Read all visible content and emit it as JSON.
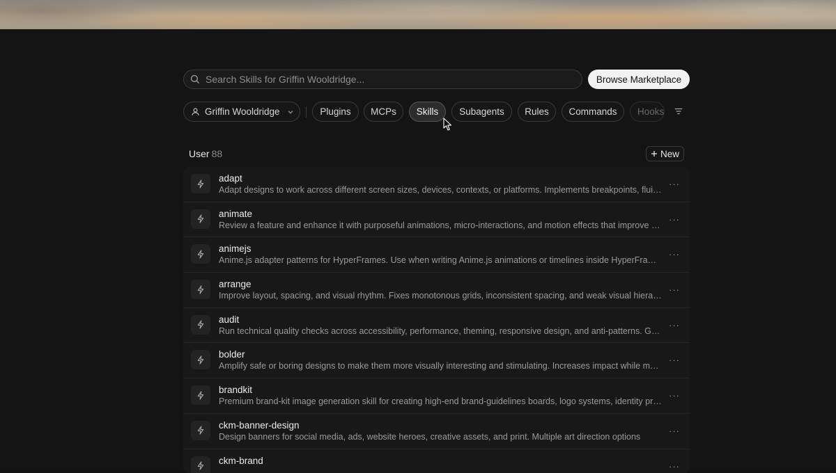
{
  "search": {
    "placeholder": "Search Skills for Griffin Wooldridge...",
    "browse_label": "Browse Marketplace"
  },
  "filters": {
    "user_label": "Griffin Wooldridge",
    "tabs": [
      "Plugins",
      "MCPs",
      "Skills",
      "Subagents",
      "Rules",
      "Commands",
      "Hooks"
    ],
    "active_tab": "Skills"
  },
  "section": {
    "title": "User",
    "count": "88",
    "new_label": "New"
  },
  "skills": [
    {
      "name": "adapt",
      "description": "Adapt designs to work across different screen sizes, devices, contexts, or platforms. Implements breakpoints, fluid layouts"
    },
    {
      "name": "animate",
      "description": "Review a feature and enhance it with purposeful animations, micro-interactions, and motion effects that improve usability"
    },
    {
      "name": "animejs",
      "description": "Anime.js adapter patterns for HyperFrames. Use when writing Anime.js animations or timelines inside HyperFrames compositions"
    },
    {
      "name": "arrange",
      "description": "Improve layout, spacing, and visual rhythm. Fixes monotonous grids, inconsistent spacing, and weak visual hierarchy"
    },
    {
      "name": "audit",
      "description": "Run technical quality checks across accessibility, performance, theming, responsive design, and anti-patterns. Generates"
    },
    {
      "name": "bolder",
      "description": "Amplify safe or boring designs to make them more visually interesting and stimulating. Increases impact while maintaining"
    },
    {
      "name": "brandkit",
      "description": "Premium brand-kit image generation skill for creating high-end brand-guidelines boards, logo systems, identity presentations"
    },
    {
      "name": "ckm-banner-design",
      "description": "Design banners for social media, ads, website heroes, creative assets, and print. Multiple art direction options"
    },
    {
      "name": "ckm-brand",
      "description": ""
    }
  ],
  "more_label": "···"
}
